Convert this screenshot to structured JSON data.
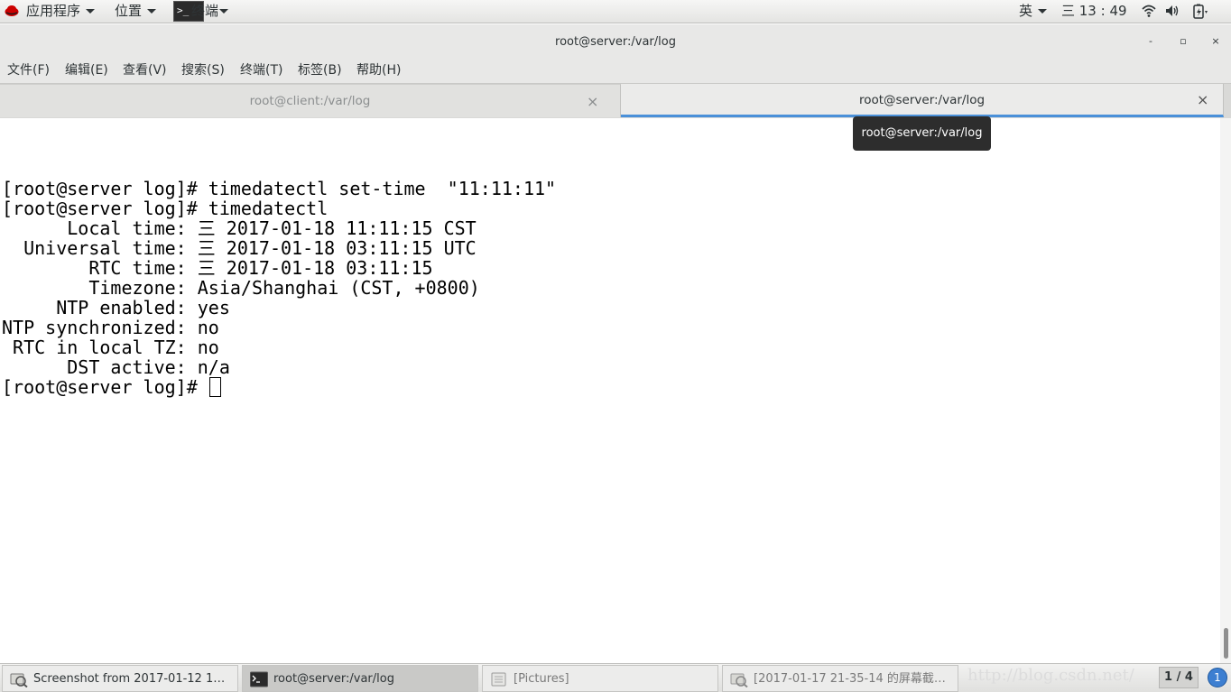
{
  "top_panel": {
    "apps_menu": "应用程序",
    "places_menu": "位置",
    "terminal_app": "终端",
    "input_method": "英",
    "clock": "三 13 : 49",
    "icons": [
      "redhat-icon",
      "wifi-icon",
      "volume-icon",
      "battery-icon"
    ]
  },
  "window": {
    "title": "root@server:/var/log",
    "controls": {
      "minimize": "-",
      "maximize": "▫",
      "close": "×"
    }
  },
  "menubar": {
    "items": [
      "文件(F)",
      "编辑(E)",
      "查看(V)",
      "搜索(S)",
      "终端(T)",
      "标签(B)",
      "帮助(H)"
    ]
  },
  "tabs": [
    {
      "label": "root@client:/var/log",
      "active": false,
      "close": "×"
    },
    {
      "label": "root@server:/var/log",
      "active": true,
      "close": "×"
    }
  ],
  "tooltip": "root@server:/var/log",
  "terminal": {
    "lines": [
      "[root@server log]# timedatectl set-time  \"11:11:11\"",
      "[root@server log]# timedatectl",
      "      Local time: 三 2017-01-18 11:11:15 CST",
      "  Universal time: 三 2017-01-18 03:11:15 UTC",
      "        RTC time: 三 2017-01-18 03:11:15",
      "        Timezone: Asia/Shanghai (CST, +0800)",
      "     NTP enabled: yes",
      "NTP synchronized: no",
      " RTC in local TZ: no",
      "      DST active: n/a"
    ],
    "prompt": "[root@server log]# "
  },
  "taskbar": {
    "tasks": [
      {
        "label": "Screenshot from 2017-01-12 1…",
        "icon": "screenshot-icon",
        "active": false
      },
      {
        "label": "root@server:/var/log",
        "icon": "terminal-icon",
        "active": true
      },
      {
        "label": "[Pictures]",
        "icon": "folder-icon",
        "active": false
      },
      {
        "label": "[2017-01-17 21-35-14 的屏幕截…",
        "icon": "screenshot-icon",
        "active": false
      }
    ],
    "watermark": "http://blog.csdn.net/",
    "workspace": "1 / 4",
    "notifications": "1"
  },
  "colors": {
    "accent": "#4a90d9",
    "tooltip_bg": "#2d2d2d",
    "terminal_bg": "#ffffff"
  }
}
